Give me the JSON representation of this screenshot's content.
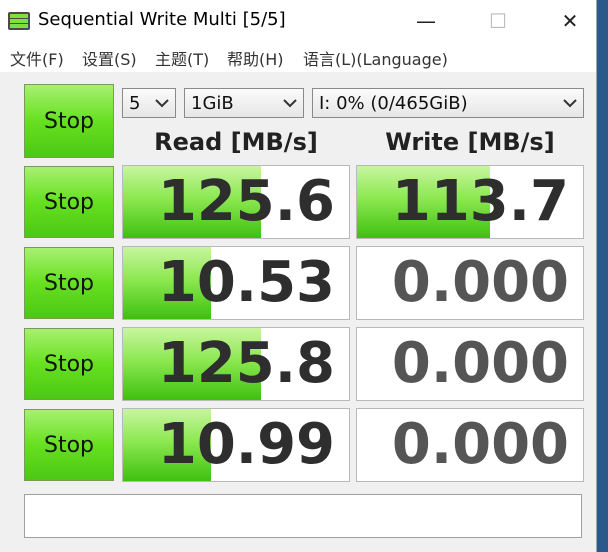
{
  "window": {
    "title": "Sequential Write Multi [5/5]",
    "minimize_glyph": "—",
    "maximize_glyph": "☐",
    "close_glyph": "✕"
  },
  "menu": [
    {
      "label": "文件(F)"
    },
    {
      "label": "设置(S)"
    },
    {
      "label": "主题(T)"
    },
    {
      "label": "帮助(H)"
    },
    {
      "label": "语言(L)(Language)"
    }
  ],
  "controls": {
    "main_button": "Stop",
    "count": "5",
    "size": "1GiB",
    "drive": "I: 0% (0/465GiB)"
  },
  "headers": {
    "read": "Read [MB/s]",
    "write": "Write [MB/s]"
  },
  "rows": [
    {
      "button": "Stop",
      "read": "125.6",
      "write": "113.7",
      "read_fill": 0.61,
      "write_fill": 0.59
    },
    {
      "button": "Stop",
      "read": "10.53",
      "write": "0.000",
      "read_fill": 0.39,
      "write_fill": 0
    },
    {
      "button": "Stop",
      "read": "125.8",
      "write": "0.000",
      "read_fill": 0.61,
      "write_fill": 0
    },
    {
      "button": "Stop",
      "read": "10.99",
      "write": "0.000",
      "read_fill": 0.39,
      "write_fill": 0
    }
  ],
  "status": "",
  "colors": {
    "accent": "#66e020",
    "window_bg": "#f0f0f0"
  }
}
